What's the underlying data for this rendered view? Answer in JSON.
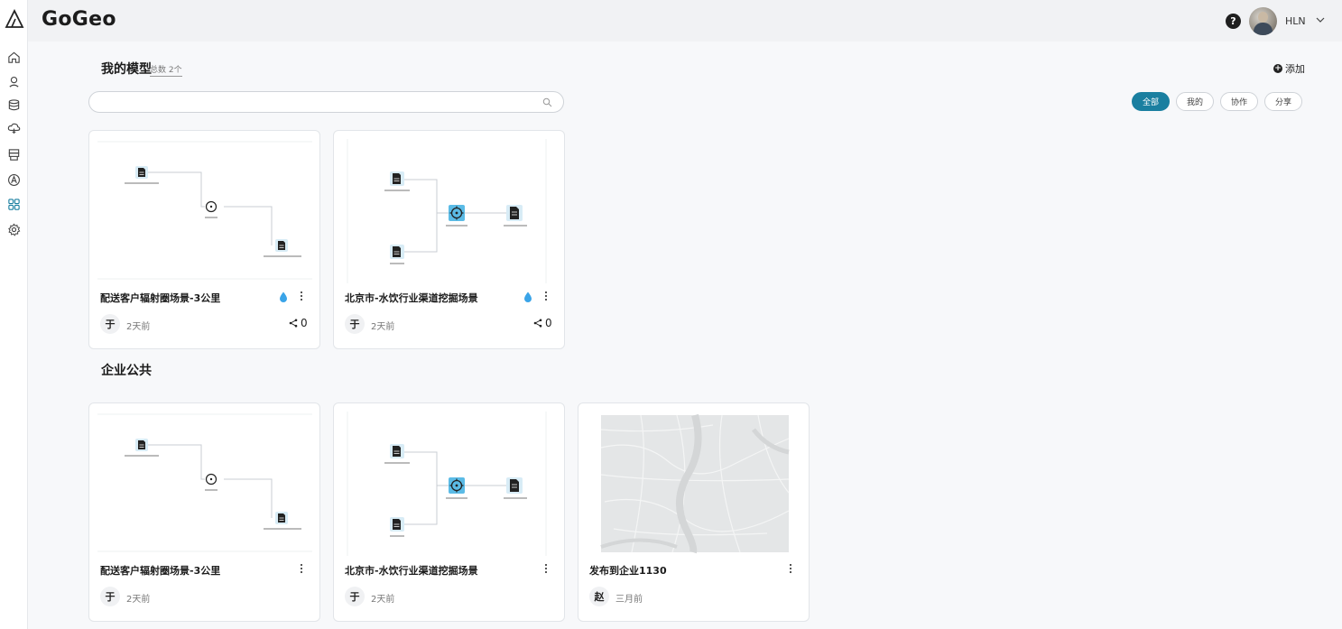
{
  "app": {
    "brand": "GoGeo"
  },
  "header": {
    "help_icon": "question-circle-icon",
    "username": "HLN"
  },
  "sidebar": {
    "items": [
      {
        "icon": "home-icon"
      },
      {
        "icon": "map-pin-icon"
      },
      {
        "icon": "database-icon"
      },
      {
        "icon": "cloud-upload-icon"
      },
      {
        "icon": "layers-stack-icon"
      },
      {
        "icon": "compass-icon"
      },
      {
        "icon": "grid-apps-icon",
        "active": true
      },
      {
        "icon": "settings-gear-icon"
      }
    ]
  },
  "my_models": {
    "title": "我的模型",
    "count": "总数 2个",
    "add_label": "添加",
    "search_placeholder": "",
    "filters": [
      {
        "label": "全部",
        "active": true
      },
      {
        "label": "我的",
        "active": false
      },
      {
        "label": "协作",
        "active": false
      },
      {
        "label": "分享",
        "active": false
      }
    ],
    "cards": [
      {
        "title": "配送客户辐射圈场景-3公里",
        "owner": "于",
        "time": "2天前",
        "shares": "0",
        "thumb": "flow-a"
      },
      {
        "title": "北京市-水饮行业渠道挖掘场景",
        "owner": "于",
        "time": "2天前",
        "shares": "0",
        "thumb": "flow-b"
      }
    ]
  },
  "enterprise": {
    "title": "企业公共",
    "cards": [
      {
        "title": "配送客户辐射圈场景-3公里",
        "owner": "于",
        "time": "2天前",
        "thumb": "flow-a"
      },
      {
        "title": "北京市-水饮行业渠道挖掘场景",
        "owner": "于",
        "time": "2天前",
        "thumb": "flow-b"
      },
      {
        "title": "发布到企业1130",
        "owner": "赵",
        "time": "三月前",
        "thumb": "map"
      }
    ]
  },
  "colors": {
    "accent": "#1a7fa0",
    "drop": "#3aa4e8",
    "node_bg": "#d8ecf6",
    "node_active": "#5bbbe6"
  }
}
